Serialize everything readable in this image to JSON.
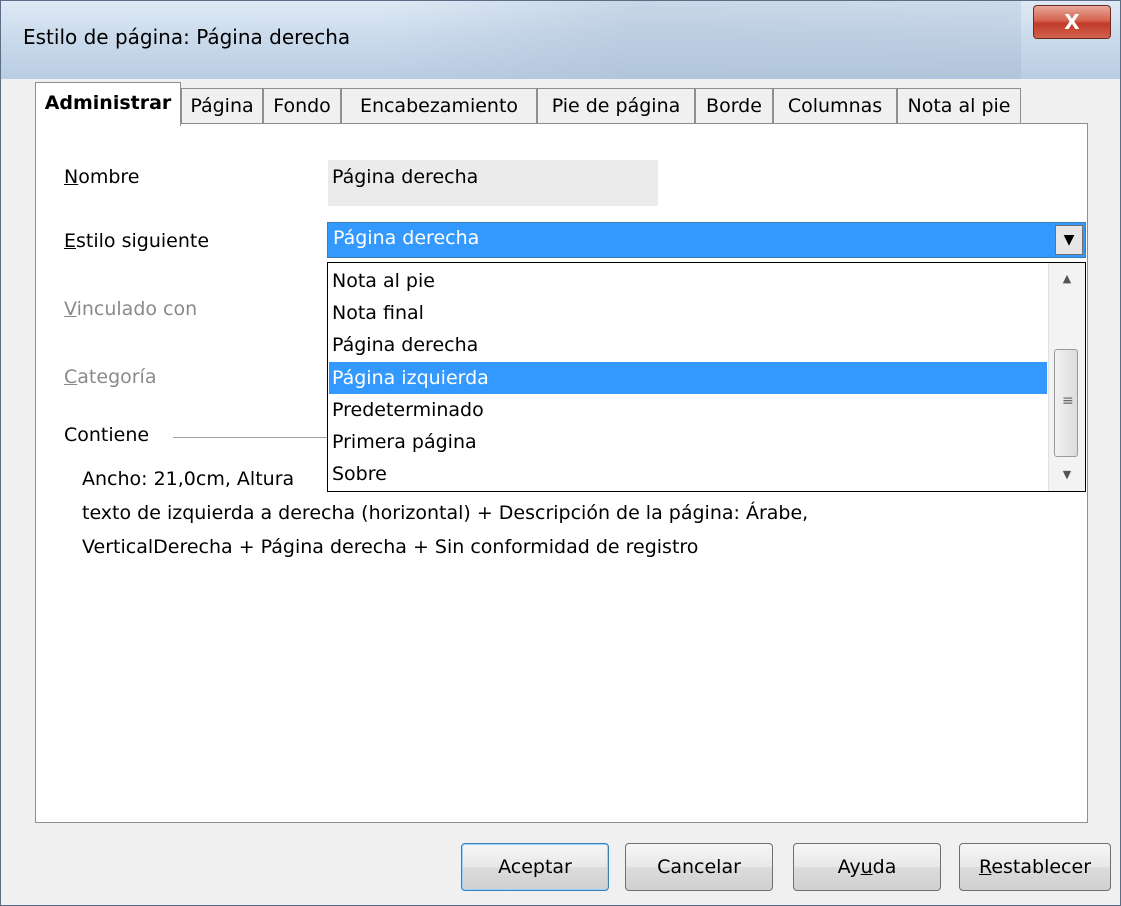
{
  "window": {
    "title": "Estilo de página: Página derecha",
    "close_label": "X"
  },
  "tabs": [
    {
      "label": "Administrar",
      "active": true
    },
    {
      "label": "Página"
    },
    {
      "label": "Fondo"
    },
    {
      "label": "Encabezamiento"
    },
    {
      "label": "Pie de página"
    },
    {
      "label": "Borde"
    },
    {
      "label": "Columnas"
    },
    {
      "label": "Nota al pie"
    }
  ],
  "form": {
    "nombre_label": {
      "underlined": "N",
      "rest": "ombre"
    },
    "nombre_value": "Página derecha",
    "estilo_label": {
      "underlined": "E",
      "rest": "stilo siguiente"
    },
    "estilo_value": "Página derecha",
    "vinculado_label": {
      "underlined": "V",
      "rest": "inculado con"
    },
    "categoria_label": {
      "underlined": "C",
      "rest": "ategoría"
    },
    "contiene_label": "Contiene"
  },
  "dropdown": {
    "options": [
      "Nota al pie",
      "Nota final",
      "Página derecha",
      "Página izquierda",
      "Predeterminado",
      "Primera página",
      "Sobre"
    ],
    "highlighted": "Página izquierda",
    "scroll_up": "▲",
    "scroll_down": "▼",
    "grip": "≡",
    "combo_arrow": "▼"
  },
  "description": {
    "line1": "Ancho: 21,0cm, Altura",
    "line2": "texto de izquierda a derecha (horizontal) + Descripción de la página:  Árabe,",
    "line3": "VerticalDerecha + Página derecha + Sin conformidad de registro"
  },
  "buttons": {
    "aceptar": "Aceptar",
    "cancelar": "Cancelar",
    "ayuda": {
      "before": "Ay",
      "underlined": "u",
      "after": "da"
    },
    "restablecer": {
      "underlined": "R",
      "rest": "establecer"
    }
  }
}
